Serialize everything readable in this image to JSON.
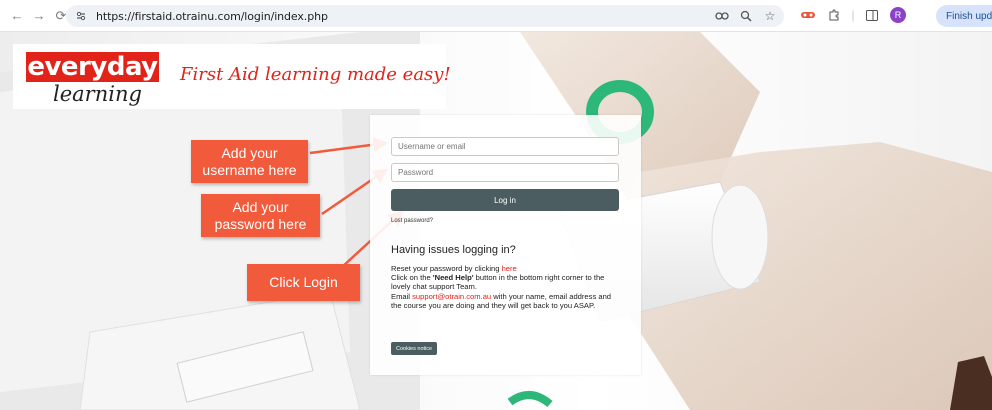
{
  "browser": {
    "url": "https://firstaid.otrainu.com/login/index.php",
    "finish_update_label": "Finish update",
    "profile_initial": "R",
    "icons": [
      "back-icon",
      "forward-icon",
      "reload-icon",
      "site-info-icon",
      "password-key-icon",
      "zoom-icon",
      "bookmark-star-icon",
      "extension-icon",
      "puzzle-icon",
      "sidebar-icon"
    ]
  },
  "branding": {
    "logo_top": "everyday",
    "logo_bottom": "learning",
    "tagline": "First Aid learning made easy!",
    "accent_color": "#e2231a"
  },
  "callouts": {
    "username": "Add your username here",
    "password": "Add your password here",
    "login": "Click Login",
    "color": "#f25a3c"
  },
  "login": {
    "username_placeholder": "Username or email",
    "password_placeholder": "Password",
    "login_button": "Log in",
    "lost_password": "Lost password?",
    "button_color": "#4b5d60"
  },
  "help": {
    "title": "Having issues logging in?",
    "line1_prefix": "Reset your password by clicking ",
    "line1_link": "here",
    "line2_prefix": "Click on the ",
    "line2_bold": "'Need Help'",
    "line2_suffix": " button in the bottom right corner to the lovely chat support Team.",
    "line3_prefix": "Email ",
    "line3_email": "support@otrain.com.au",
    "line3_suffix": " with your name, email address and the course you are doing and they will get back to you ASAP."
  },
  "cookies_notice": "Cookies notice"
}
